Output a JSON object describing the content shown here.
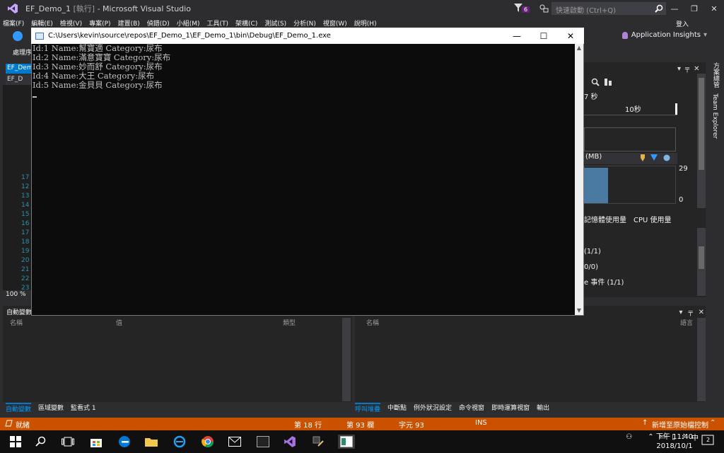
{
  "vs": {
    "title_prefix": "EF_Demo_1",
    "title_running": "[執行]",
    "title_suffix": "- Microsoft Visual Studio",
    "notification_count": "6",
    "quick_launch_placeholder": "快速啟動 (Ctrl+Q)",
    "menu": [
      "檔案(F)",
      "編輯(E)",
      "檢視(V)",
      "專案(P)",
      "建置(B)",
      "偵錯(D)",
      "小組(M)",
      "工具(T)",
      "架構(C)",
      "測試(S)",
      "分析(N)",
      "視窗(W)",
      "說明(H)"
    ],
    "signin": "登入",
    "app_insights": "Application Insights",
    "process_label": "處理序",
    "doc_tab": "EF_Dem",
    "doc_sub": "EF_D",
    "line_numbers": [
      "17",
      "12",
      "13",
      "14",
      "15",
      "16",
      "17",
      "18",
      "19",
      "20",
      "21",
      "22",
      "23"
    ],
    "zoom": "100 %"
  },
  "diagnostics": {
    "seconds_label": "7 秒",
    "timeline_label": "10秒",
    "memory_header": "(MB)",
    "mem_max": "29",
    "mem_min": "0",
    "tabs": [
      "記憶體使用量",
      "CPU 使用量"
    ],
    "list": [
      "(1/1)",
      "0/0)",
      "e 事件 (1/1)"
    ],
    "rail": [
      "方案總管",
      "Team Explorer"
    ]
  },
  "autos": {
    "title": "自動變數",
    "columns": [
      "名稱",
      "值",
      "類型"
    ]
  },
  "callstack": {
    "columns": [
      "名稱",
      "語言"
    ]
  },
  "bottom_tabs_left": [
    "自動變數",
    "區域變數",
    "監看式 1"
  ],
  "bottom_tabs_right": [
    "呼叫堆疊",
    "中斷點",
    "例外狀況設定",
    "命令視窗",
    "即時運算視窗",
    "輸出"
  ],
  "status": {
    "ready": "就緒",
    "line": "第 18 行",
    "col": "第 93 欄",
    "ch": "字元 93",
    "ins": "INS",
    "source_control": "新增至原始檔控制"
  },
  "console": {
    "path": "C:\\Users\\kevin\\source\\repos\\EF_Demo_1\\EF_Demo_1\\bin\\Debug\\EF_Demo_1.exe",
    "lines": [
      "Id:1 Name:幫寶適 Category:尿布",
      "Id:2 Name:滿意寶寶 Category:尿布",
      "Id:3 Name:妙而舒 Category:尿布",
      "Id:4 Name:大王 Category:尿布",
      "Id:5 Name:金貝貝 Category:尿布"
    ]
  },
  "taskbar": {
    "ime": "中",
    "time": "下午 11:40",
    "date": "2018/10/1",
    "notif_count": "2"
  }
}
